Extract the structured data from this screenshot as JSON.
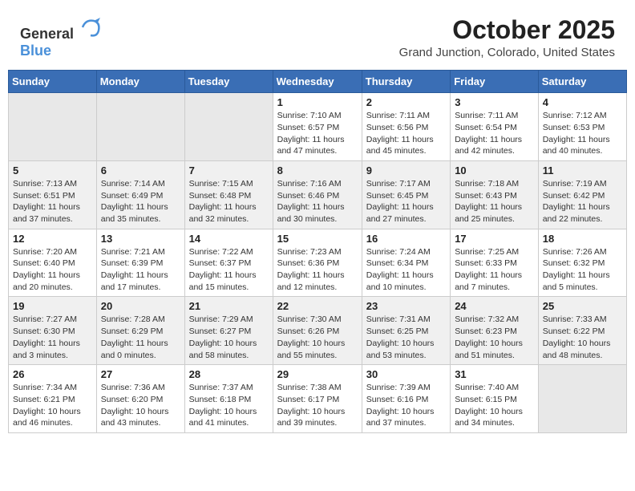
{
  "header": {
    "logo_general": "General",
    "logo_blue": "Blue",
    "month": "October 2025",
    "location": "Grand Junction, Colorado, United States"
  },
  "weekdays": [
    "Sunday",
    "Monday",
    "Tuesday",
    "Wednesday",
    "Thursday",
    "Friday",
    "Saturday"
  ],
  "weeks": [
    [
      {
        "day": "",
        "sunrise": "",
        "sunset": "",
        "daylight": ""
      },
      {
        "day": "",
        "sunrise": "",
        "sunset": "",
        "daylight": ""
      },
      {
        "day": "",
        "sunrise": "",
        "sunset": "",
        "daylight": ""
      },
      {
        "day": "1",
        "sunrise": "Sunrise: 7:10 AM",
        "sunset": "Sunset: 6:57 PM",
        "daylight": "Daylight: 11 hours and 47 minutes."
      },
      {
        "day": "2",
        "sunrise": "Sunrise: 7:11 AM",
        "sunset": "Sunset: 6:56 PM",
        "daylight": "Daylight: 11 hours and 45 minutes."
      },
      {
        "day": "3",
        "sunrise": "Sunrise: 7:11 AM",
        "sunset": "Sunset: 6:54 PM",
        "daylight": "Daylight: 11 hours and 42 minutes."
      },
      {
        "day": "4",
        "sunrise": "Sunrise: 7:12 AM",
        "sunset": "Sunset: 6:53 PM",
        "daylight": "Daylight: 11 hours and 40 minutes."
      }
    ],
    [
      {
        "day": "5",
        "sunrise": "Sunrise: 7:13 AM",
        "sunset": "Sunset: 6:51 PM",
        "daylight": "Daylight: 11 hours and 37 minutes."
      },
      {
        "day": "6",
        "sunrise": "Sunrise: 7:14 AM",
        "sunset": "Sunset: 6:49 PM",
        "daylight": "Daylight: 11 hours and 35 minutes."
      },
      {
        "day": "7",
        "sunrise": "Sunrise: 7:15 AM",
        "sunset": "Sunset: 6:48 PM",
        "daylight": "Daylight: 11 hours and 32 minutes."
      },
      {
        "day": "8",
        "sunrise": "Sunrise: 7:16 AM",
        "sunset": "Sunset: 6:46 PM",
        "daylight": "Daylight: 11 hours and 30 minutes."
      },
      {
        "day": "9",
        "sunrise": "Sunrise: 7:17 AM",
        "sunset": "Sunset: 6:45 PM",
        "daylight": "Daylight: 11 hours and 27 minutes."
      },
      {
        "day": "10",
        "sunrise": "Sunrise: 7:18 AM",
        "sunset": "Sunset: 6:43 PM",
        "daylight": "Daylight: 11 hours and 25 minutes."
      },
      {
        "day": "11",
        "sunrise": "Sunrise: 7:19 AM",
        "sunset": "Sunset: 6:42 PM",
        "daylight": "Daylight: 11 hours and 22 minutes."
      }
    ],
    [
      {
        "day": "12",
        "sunrise": "Sunrise: 7:20 AM",
        "sunset": "Sunset: 6:40 PM",
        "daylight": "Daylight: 11 hours and 20 minutes."
      },
      {
        "day": "13",
        "sunrise": "Sunrise: 7:21 AM",
        "sunset": "Sunset: 6:39 PM",
        "daylight": "Daylight: 11 hours and 17 minutes."
      },
      {
        "day": "14",
        "sunrise": "Sunrise: 7:22 AM",
        "sunset": "Sunset: 6:37 PM",
        "daylight": "Daylight: 11 hours and 15 minutes."
      },
      {
        "day": "15",
        "sunrise": "Sunrise: 7:23 AM",
        "sunset": "Sunset: 6:36 PM",
        "daylight": "Daylight: 11 hours and 12 minutes."
      },
      {
        "day": "16",
        "sunrise": "Sunrise: 7:24 AM",
        "sunset": "Sunset: 6:34 PM",
        "daylight": "Daylight: 11 hours and 10 minutes."
      },
      {
        "day": "17",
        "sunrise": "Sunrise: 7:25 AM",
        "sunset": "Sunset: 6:33 PM",
        "daylight": "Daylight: 11 hours and 7 minutes."
      },
      {
        "day": "18",
        "sunrise": "Sunrise: 7:26 AM",
        "sunset": "Sunset: 6:32 PM",
        "daylight": "Daylight: 11 hours and 5 minutes."
      }
    ],
    [
      {
        "day": "19",
        "sunrise": "Sunrise: 7:27 AM",
        "sunset": "Sunset: 6:30 PM",
        "daylight": "Daylight: 11 hours and 3 minutes."
      },
      {
        "day": "20",
        "sunrise": "Sunrise: 7:28 AM",
        "sunset": "Sunset: 6:29 PM",
        "daylight": "Daylight: 11 hours and 0 minutes."
      },
      {
        "day": "21",
        "sunrise": "Sunrise: 7:29 AM",
        "sunset": "Sunset: 6:27 PM",
        "daylight": "Daylight: 10 hours and 58 minutes."
      },
      {
        "day": "22",
        "sunrise": "Sunrise: 7:30 AM",
        "sunset": "Sunset: 6:26 PM",
        "daylight": "Daylight: 10 hours and 55 minutes."
      },
      {
        "day": "23",
        "sunrise": "Sunrise: 7:31 AM",
        "sunset": "Sunset: 6:25 PM",
        "daylight": "Daylight: 10 hours and 53 minutes."
      },
      {
        "day": "24",
        "sunrise": "Sunrise: 7:32 AM",
        "sunset": "Sunset: 6:23 PM",
        "daylight": "Daylight: 10 hours and 51 minutes."
      },
      {
        "day": "25",
        "sunrise": "Sunrise: 7:33 AM",
        "sunset": "Sunset: 6:22 PM",
        "daylight": "Daylight: 10 hours and 48 minutes."
      }
    ],
    [
      {
        "day": "26",
        "sunrise": "Sunrise: 7:34 AM",
        "sunset": "Sunset: 6:21 PM",
        "daylight": "Daylight: 10 hours and 46 minutes."
      },
      {
        "day": "27",
        "sunrise": "Sunrise: 7:36 AM",
        "sunset": "Sunset: 6:20 PM",
        "daylight": "Daylight: 10 hours and 43 minutes."
      },
      {
        "day": "28",
        "sunrise": "Sunrise: 7:37 AM",
        "sunset": "Sunset: 6:18 PM",
        "daylight": "Daylight: 10 hours and 41 minutes."
      },
      {
        "day": "29",
        "sunrise": "Sunrise: 7:38 AM",
        "sunset": "Sunset: 6:17 PM",
        "daylight": "Daylight: 10 hours and 39 minutes."
      },
      {
        "day": "30",
        "sunrise": "Sunrise: 7:39 AM",
        "sunset": "Sunset: 6:16 PM",
        "daylight": "Daylight: 10 hours and 37 minutes."
      },
      {
        "day": "31",
        "sunrise": "Sunrise: 7:40 AM",
        "sunset": "Sunset: 6:15 PM",
        "daylight": "Daylight: 10 hours and 34 minutes."
      },
      {
        "day": "",
        "sunrise": "",
        "sunset": "",
        "daylight": ""
      }
    ]
  ]
}
